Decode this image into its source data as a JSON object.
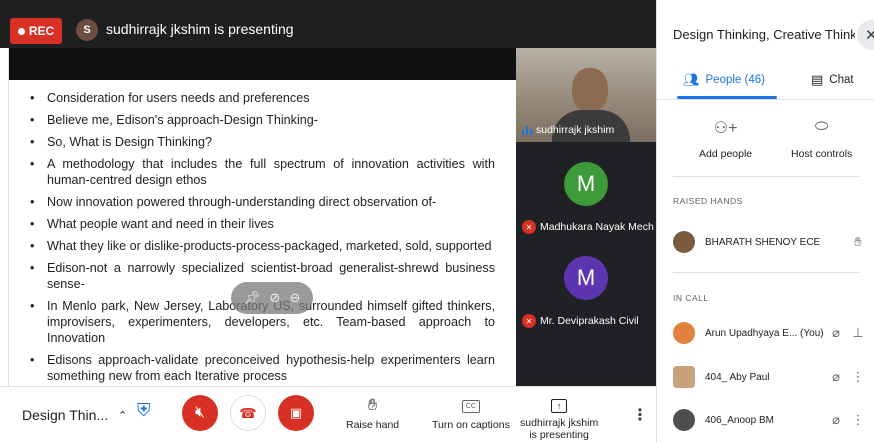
{
  "top_bar": {
    "rec_label": "REC",
    "presenter_initial": "S",
    "presenting_text": "sudhirrajk jkshim is presenting"
  },
  "slide": {
    "bullets": [
      "Consideration for users needs and preferences",
      "Believe me, Edison's approach-Design Thinking-",
      "So, What is Design Thinking?",
      "A methodology that includes the full spectrum of innovation activities with human-centred design ethos",
      "Now innovation powered through-understanding direct observation of-",
      "What people want and need in their lives",
      "What they like or dislike-products-process-packaged, marketed, sold, supported",
      "Edison-not a narrowly specialized scientist-broad generalist-shrewd business sense-",
      "In Menlo park, New Jersey, Laboratory US, surrounded himself gifted thinkers, improvisers, experimenters, developers, etc. Team-based approach to Innovation",
      "Edisons approach-validate preconceived hypothesis-help experimenters learn something new from each Iterative process"
    ]
  },
  "tiles": {
    "video_name": "sudhirrajk jkshim",
    "tile2": {
      "initial": "M",
      "name": "Madhukara Nayak Mech",
      "color": "#3c9a39"
    },
    "tile3": {
      "initial": "M",
      "name": "Mr. Deviprakash Civil",
      "color": "#5e35b1"
    }
  },
  "bottom_bar": {
    "meeting_name": "Design Thin...",
    "raise_hand_label": "Raise hand",
    "captions_label": "Turn on captions",
    "cc_glyph": "CC",
    "presenting_label_line1": "sudhirrajk jkshim",
    "presenting_label_line2": "is presenting"
  },
  "panel": {
    "title": "Design Thinking, Creative Thinkin...",
    "tab_people": "People (46)",
    "tab_chat": "Chat",
    "add_people": "Add people",
    "host_controls": "Host controls",
    "raised_hands_label": "RAISED HANDS",
    "in_call_label": "IN CALL",
    "raised": [
      {
        "name": "BHARATH SHENOY ECE"
      }
    ],
    "in_call": [
      {
        "name": "Arun Upadhyaya E... (You)"
      },
      {
        "name": "404_ Aby Paul"
      },
      {
        "name": "406_Anoop BM"
      }
    ]
  },
  "colors": {
    "accent": "#1a73e8",
    "danger": "#d93025",
    "dark": "#1f1f1f"
  }
}
